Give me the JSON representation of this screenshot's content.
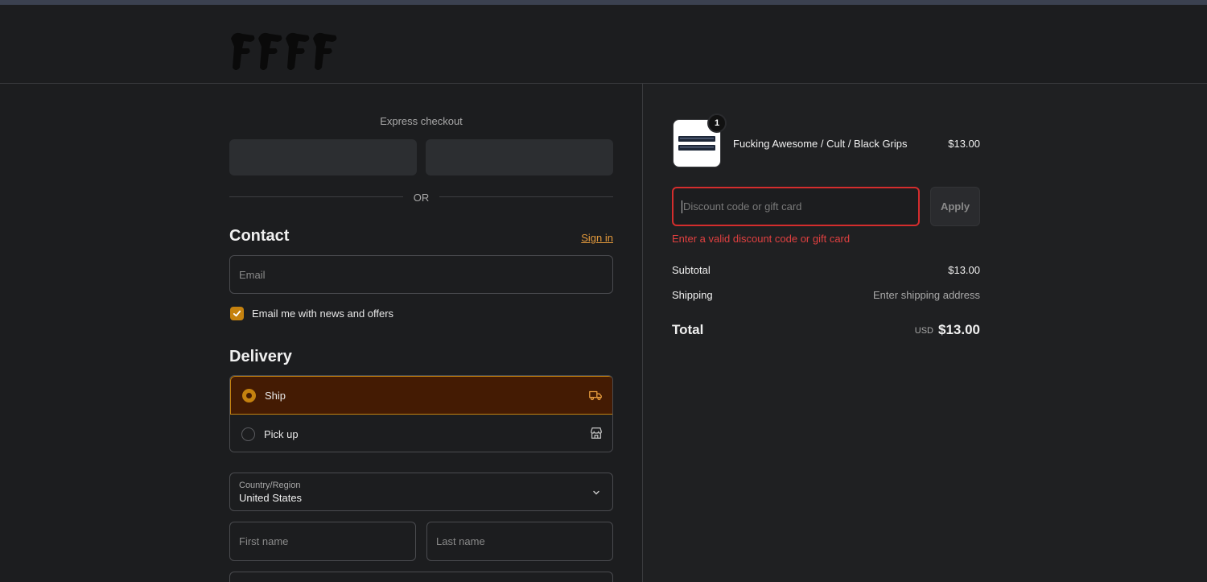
{
  "colors": {
    "background": "#1c1d1f",
    "accent": "#c5820f",
    "selected_bg": "#441b03",
    "error": "#d42d2d",
    "link": "#e49a3c"
  },
  "express": {
    "title": "Express checkout",
    "or_text": "OR"
  },
  "contact": {
    "title": "Contact",
    "sign_in": "Sign in",
    "email_placeholder": "Email",
    "newsletter_label": "Email me with news and offers",
    "newsletter_checked": true
  },
  "delivery": {
    "title": "Delivery",
    "options": [
      {
        "label": "Ship",
        "selected": true,
        "icon": "truck-icon"
      },
      {
        "label": "Pick up",
        "selected": false,
        "icon": "store-icon"
      }
    ],
    "country_label": "Country/Region",
    "country_value": "United States",
    "first_name_placeholder": "First name",
    "last_name_placeholder": "Last name"
  },
  "order": {
    "product_name": "Fucking Awesome / Cult / Black Grips",
    "product_price": "$13.00",
    "quantity": "1",
    "discount_placeholder": "Discount code or gift card",
    "apply_label": "Apply",
    "discount_error": "Enter a valid discount code or gift card",
    "subtotal_label": "Subtotal",
    "subtotal_value": "$13.00",
    "shipping_label": "Shipping",
    "shipping_value": "Enter shipping address",
    "total_label": "Total",
    "total_currency": "USD",
    "total_value": "$13.00"
  }
}
